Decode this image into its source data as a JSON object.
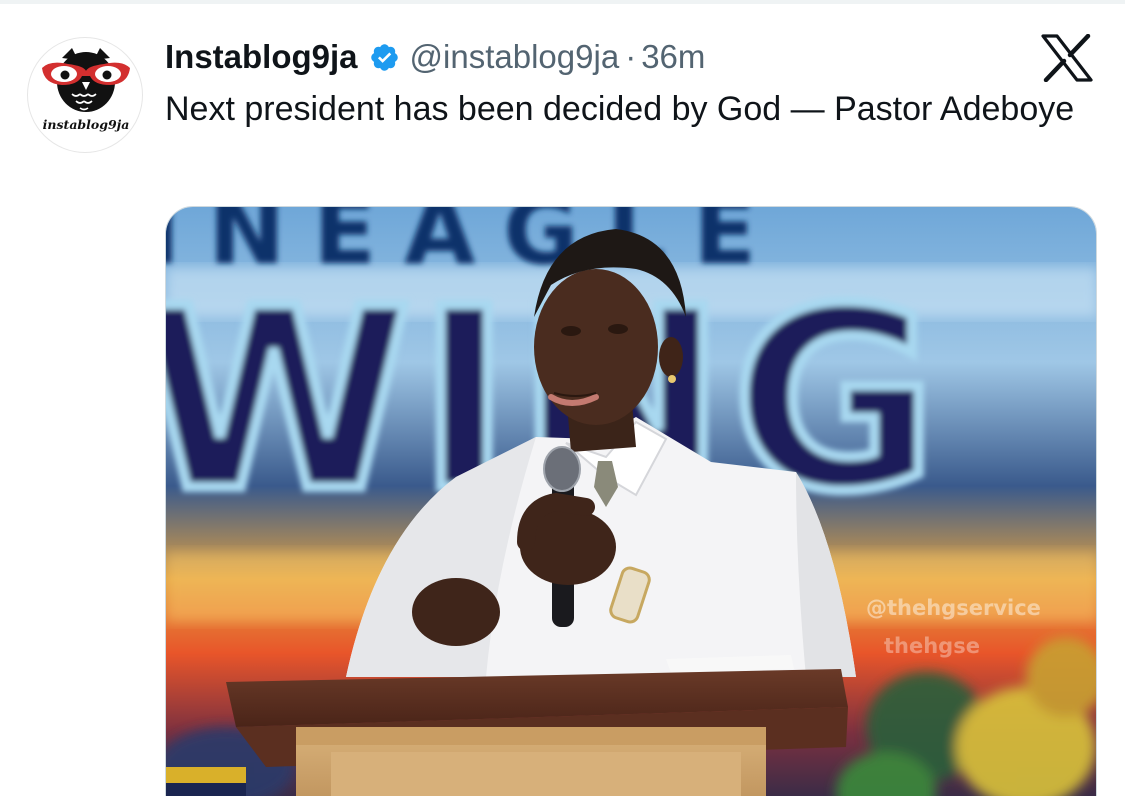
{
  "tweet": {
    "display_name": "Instablog9ja",
    "handle": "@instablog9ja",
    "separator": "·",
    "time": "36m",
    "text": "Next president has been decided by God — Pastor Adeboye",
    "verified": true
  },
  "avatar": {
    "icon": "owl-logo-icon",
    "wordmark": "instablog9ja"
  },
  "platform": {
    "icon": "x-logo-icon"
  },
  "media": {
    "backdrop_letters_top": "INEAGLE",
    "backdrop_letters_main": "WING",
    "watermark_line_1": "@thehgservice",
    "watermark_line_2": "thehgse"
  },
  "colors": {
    "verified_blue": "#1d9bf0",
    "secondary_text": "#536471",
    "primary_text": "#0f1419",
    "avatar_glasses_red": "#d32f2f"
  }
}
